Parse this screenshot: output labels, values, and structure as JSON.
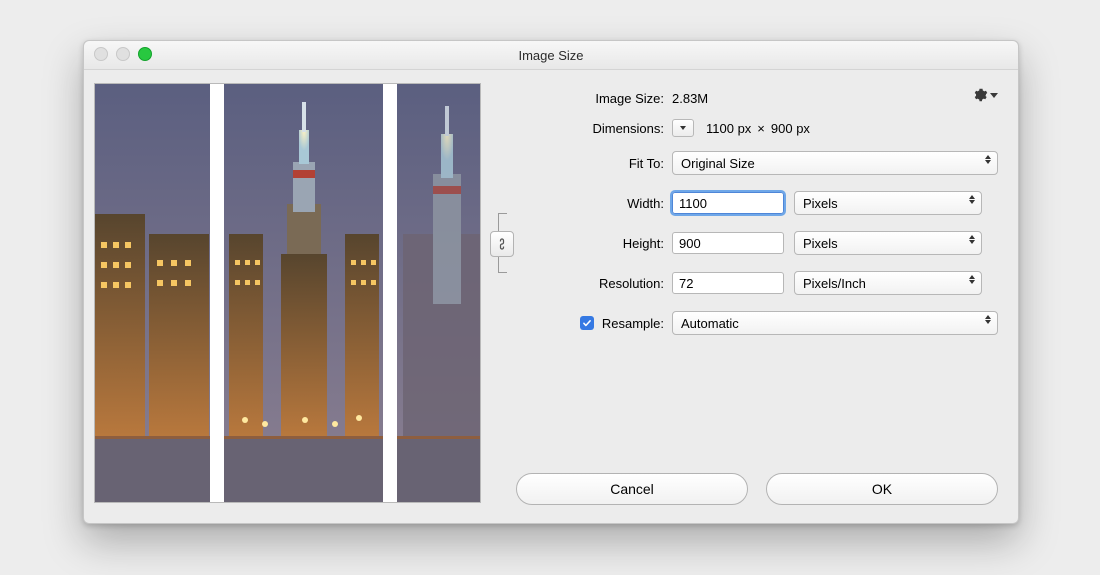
{
  "title": "Image Size",
  "imageSize": {
    "label": "Image Size:",
    "value": "2.83M"
  },
  "dimensions": {
    "label": "Dimensions:",
    "w": "1100 px",
    "h": "900 px",
    "times": "×"
  },
  "fitTo": {
    "label": "Fit To:",
    "value": "Original Size"
  },
  "width": {
    "label": "Width:",
    "value": "1100",
    "units": "Pixels"
  },
  "height": {
    "label": "Height:",
    "value": "900",
    "units": "Pixels"
  },
  "resolution": {
    "label": "Resolution:",
    "value": "72",
    "units": "Pixels/Inch"
  },
  "resample": {
    "label": "Resample:",
    "value": "Automatic",
    "checked": true
  },
  "buttons": {
    "cancel": "Cancel",
    "ok": "OK"
  }
}
